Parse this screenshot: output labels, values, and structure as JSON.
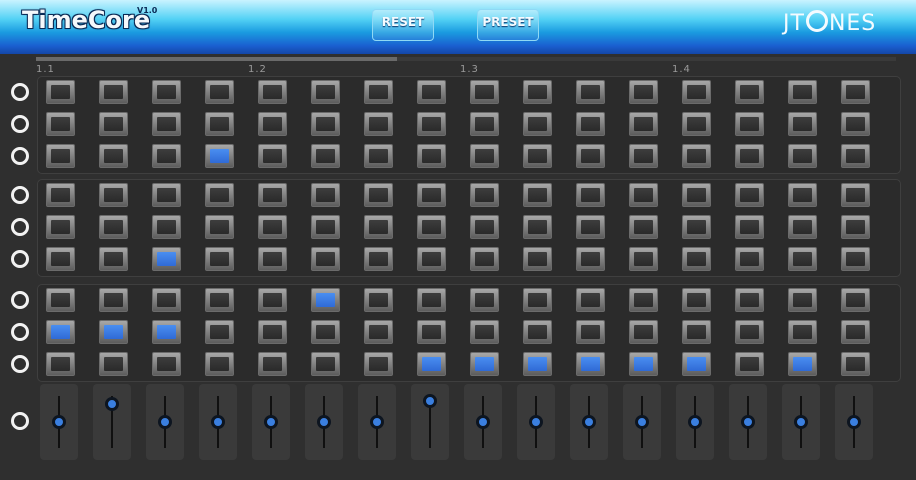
{
  "header": {
    "logo": "TimeCore",
    "version": "V1.0",
    "reset_label": "RESET",
    "preset_label": "PRESET",
    "brand_start": "JT",
    "brand_end": "NES"
  },
  "beats": [
    "1.1",
    "1.2",
    "1.3",
    "1.4"
  ],
  "playback_progress": 0.42,
  "colors": {
    "pad_on": "#3b7de6",
    "header_top": "#c9f3ff",
    "header_bottom": "#1446a8",
    "background": "#2f2f2f"
  },
  "grid": {
    "groups": 3,
    "rows_per_group": 3,
    "steps": 16,
    "active": [
      [
        [],
        [],
        [
          3
        ]
      ],
      [
        [],
        [],
        [
          2
        ]
      ],
      [
        [
          5
        ],
        [
          0,
          1,
          2
        ],
        [
          7,
          8,
          9,
          10,
          11,
          12,
          14
        ]
      ]
    ]
  },
  "sliders": {
    "count": 16,
    "values": [
      0.5,
      0.85,
      0.5,
      0.5,
      0.5,
      0.5,
      0.5,
      0.9,
      0.5,
      0.5,
      0.5,
      0.5,
      0.5,
      0.5,
      0.5,
      0.5
    ]
  }
}
